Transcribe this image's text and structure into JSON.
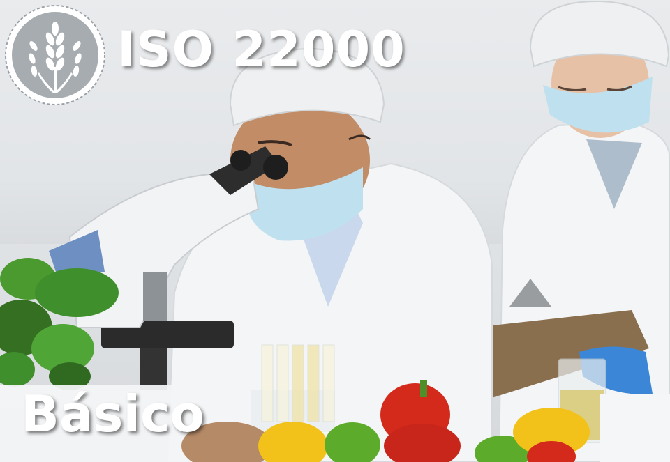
{
  "banner": {
    "title": "ISO 22000",
    "subtitle": "Básico",
    "logo_icon": "wheat-seal-icon"
  },
  "colors": {
    "title_text": "#ffffff",
    "lab_coat": "#f4f5f6",
    "mask": "#bfe0ee",
    "glove": "#3b86d6",
    "clipboard": "#8a6f4f",
    "pepper_red": "#d42a1c",
    "pepper_yellow": "#f2c21b",
    "pepper_green": "#5cab2a",
    "basil": "#3f8f2c"
  }
}
